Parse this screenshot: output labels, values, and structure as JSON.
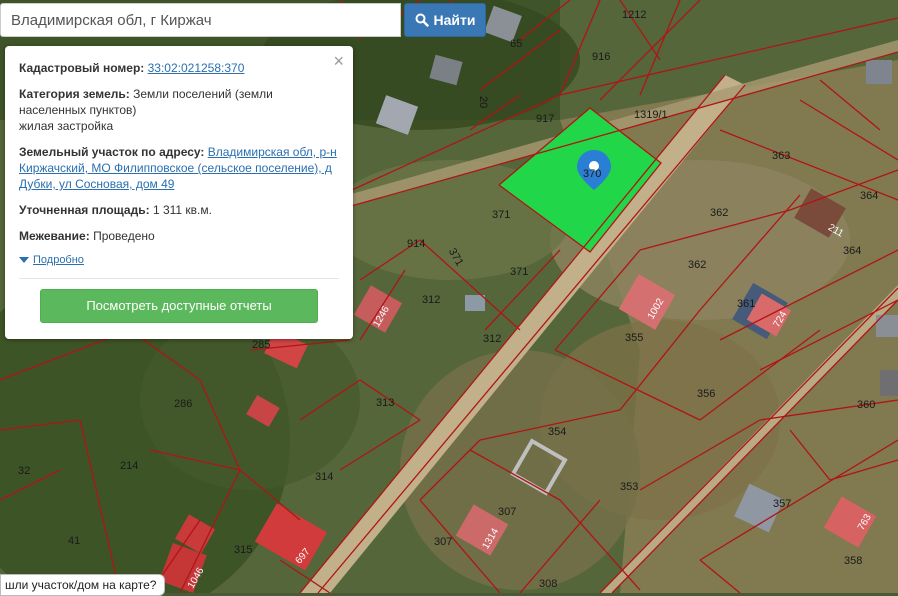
{
  "search": {
    "value": "Владимирская обл, г Киржач",
    "button_label": "Найти"
  },
  "popup": {
    "cadastral_label": "Кадастровый номер:",
    "cadastral_value": "33:02:021258:370",
    "category_label": "Категория земель:",
    "category_value_1": "Земли поселений (земли",
    "category_value_2": "населенных пунктов)",
    "category_value_3": "жилая застройка",
    "address_label": "Земельный участок по адресу:",
    "address_value": "Владимирская обл, р-н Киржачский, МО Филипповское (сельское поселение), д Дубки, ул Сосновая, дом 49",
    "area_label": "Уточненная площадь:",
    "area_value": "1 311 кв.м.",
    "survey_label": "Межевание:",
    "survey_value": "Проведено",
    "more_label": "Подробно",
    "report_button": "Посмотреть доступные отчеты",
    "close_symbol": "×"
  },
  "hint": "шли участок/дом на карте?",
  "map": {
    "highlight_color": "#22d64a",
    "boundary_color": "#b01515",
    "marker_color": "#2a7fd4",
    "highlight_label": "370",
    "plot_labels": {
      "l1212": "1212",
      "l65": "65",
      "l916": "916",
      "l20": "20",
      "l917": "917",
      "l1319": "1319/1",
      "l363": "363",
      "l364a": "364",
      "l364b": "364",
      "l211": "211",
      "l371a": "371",
      "l371b": "371",
      "l371c": "371",
      "l914": "914",
      "l362a": "362",
      "l362b": "362",
      "l312a": "312",
      "l312b": "312",
      "l1246": "1246",
      "l1002": "1002",
      "l355": "355",
      "l361": "361",
      "l724": "724",
      "l285": "285",
      "l286": "286",
      "l313": "313",
      "l356": "356",
      "l360": "360",
      "l354": "354",
      "l32": "32",
      "l214": "214",
      "l314": "314",
      "l353": "353",
      "l357": "357",
      "l41": "41",
      "l315": "315",
      "l697": "697",
      "l307a": "307",
      "l307b": "307",
      "l1314": "1314",
      "l763": "763",
      "l358": "358",
      "l1046": "1046",
      "l308": "308"
    }
  }
}
